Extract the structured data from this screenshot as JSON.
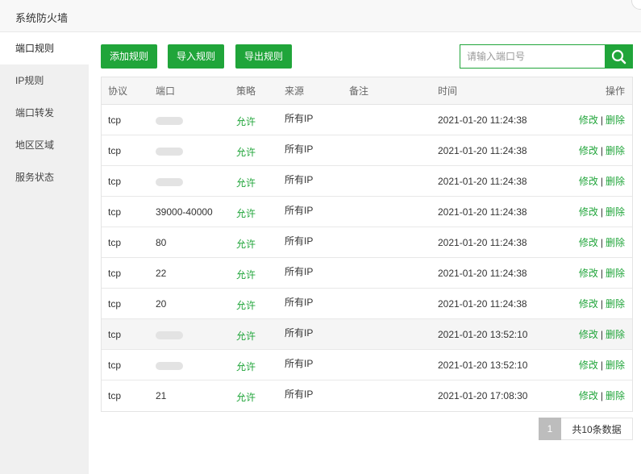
{
  "window": {
    "title": "系统防火墙"
  },
  "sidebar": {
    "items": [
      {
        "label": "端口规则",
        "active": true
      },
      {
        "label": "IP规则"
      },
      {
        "label": "端口转发"
      },
      {
        "label": "地区区域"
      },
      {
        "label": "服务状态"
      }
    ]
  },
  "toolbar": {
    "add_label": "添加规则",
    "import_label": "导入规则",
    "export_label": "导出规则"
  },
  "search": {
    "placeholder": "请输入端口号",
    "value": "",
    "icon": "search-icon"
  },
  "table": {
    "headers": {
      "protocol": "协议",
      "port": "端口",
      "strategy": "策略",
      "source": "来源",
      "note": "备注",
      "time": "时间",
      "ops": "操作"
    },
    "rows": [
      {
        "protocol": "tcp",
        "port": "",
        "strategy": "允许",
        "source": "所有IP",
        "note": "",
        "time": "2021-01-20 11:24:38",
        "edit": "修改",
        "sep": "|",
        "delete": "删除"
      },
      {
        "protocol": "tcp",
        "port": "",
        "strategy": "允许",
        "source": "所有IP",
        "note": "",
        "time": "2021-01-20 11:24:38",
        "edit": "修改",
        "sep": "|",
        "delete": "删除"
      },
      {
        "protocol": "tcp",
        "port": "",
        "strategy": "允许",
        "source": "所有IP",
        "note": "",
        "time": "2021-01-20 11:24:38",
        "edit": "修改",
        "sep": "|",
        "delete": "删除"
      },
      {
        "protocol": "tcp",
        "port": "39000-40000",
        "strategy": "允许",
        "source": "所有IP",
        "note": "",
        "time": "2021-01-20 11:24:38",
        "edit": "修改",
        "sep": "|",
        "delete": "删除"
      },
      {
        "protocol": "tcp",
        "port": "80",
        "strategy": "允许",
        "source": "所有IP",
        "note": "",
        "time": "2021-01-20 11:24:38",
        "edit": "修改",
        "sep": "|",
        "delete": "删除"
      },
      {
        "protocol": "tcp",
        "port": "22",
        "strategy": "允许",
        "source": "所有IP",
        "note": "",
        "time": "2021-01-20 11:24:38",
        "edit": "修改",
        "sep": "|",
        "delete": "删除"
      },
      {
        "protocol": "tcp",
        "port": "20",
        "strategy": "允许",
        "source": "所有IP",
        "note": "",
        "time": "2021-01-20 11:24:38",
        "edit": "修改",
        "sep": "|",
        "delete": "删除"
      },
      {
        "protocol": "tcp",
        "port": "",
        "strategy": "允许",
        "source": "所有IP",
        "note": "",
        "time": "2021-01-20 13:52:10",
        "edit": "修改",
        "sep": "|",
        "delete": "删除"
      },
      {
        "protocol": "tcp",
        "port": "",
        "strategy": "允许",
        "source": "所有IP",
        "note": "",
        "time": "2021-01-20 13:52:10",
        "edit": "修改",
        "sep": "|",
        "delete": "删除"
      },
      {
        "protocol": "tcp",
        "port": "21",
        "strategy": "允许",
        "source": "所有IP",
        "note": "",
        "time": "2021-01-20 17:08:30",
        "edit": "修改",
        "sep": "|",
        "delete": "删除"
      }
    ]
  },
  "pagination": {
    "current_page": "1",
    "total_label": "共10条数据"
  },
  "colors": {
    "accent": "#20a53a",
    "sidebar_bg": "#f0f0f0",
    "header_bg": "#f6f6f6",
    "page_active": "#bdbdbd"
  }
}
